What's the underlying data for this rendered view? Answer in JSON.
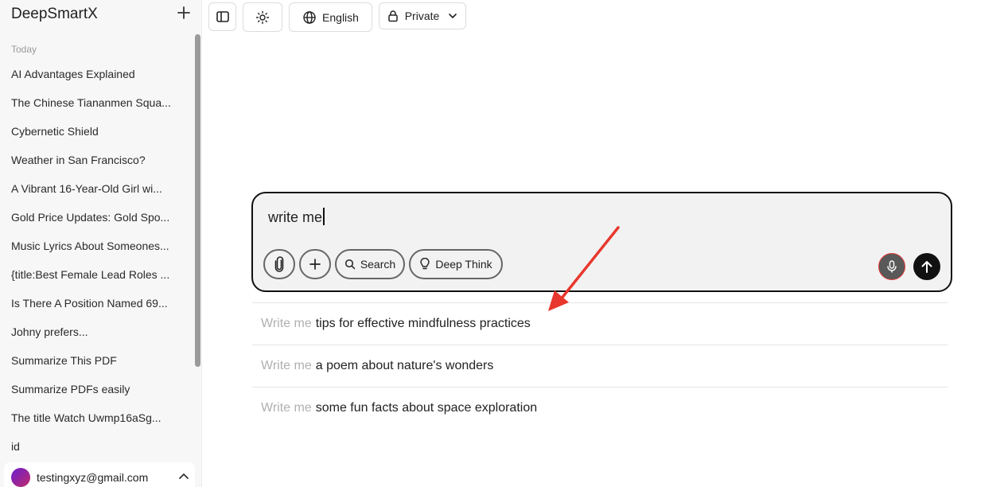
{
  "sidebar": {
    "brand": "DeepSmartX",
    "new_chat_icon": "plus-icon",
    "section_label": "Today",
    "history": [
      "AI Advantages Explained",
      "The Chinese Tiananmen Squa...",
      "Cybernetic Shield",
      "Weather in San Francisco?",
      "A Vibrant 16-Year-Old Girl wi...",
      "Gold Price Updates: Gold Spo...",
      "Music Lyrics About Someones...",
      "{title:Best Female Lead Roles ...",
      "Is There A Position Named 69...",
      "Johny prefers...",
      "Summarize This PDF",
      "Summarize PDFs easily",
      "The title Watch Uwmp16aSg...",
      "id"
    ],
    "user_email": "testingxyz@gmail.com"
  },
  "topbar": {
    "language_label": "English",
    "visibility_label": "Private"
  },
  "composer": {
    "input_value": "write me",
    "search_label": "Search",
    "deep_think_label": "Deep Think"
  },
  "suggestions": [
    {
      "prefix": "Write me",
      "rest": "tips for effective mindfulness practices"
    },
    {
      "prefix": "Write me",
      "rest": "a poem about nature's wonders"
    },
    {
      "prefix": "Write me",
      "rest": "some fun facts about space exploration"
    }
  ],
  "colors": {
    "annotation_arrow": "#e8372c",
    "mic_border": "#e53935",
    "send_button": "#111111"
  }
}
